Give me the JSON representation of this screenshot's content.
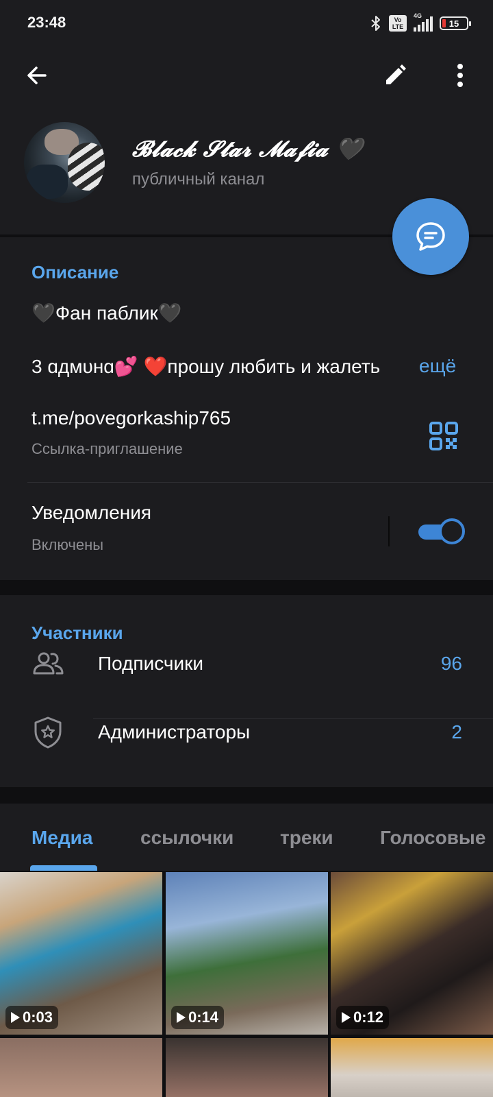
{
  "status_bar": {
    "time": "23:48",
    "network": "4G",
    "volte": "Vo LTE",
    "battery": "15"
  },
  "header": {
    "channel_name": "𝓑𝓵𝓪𝓬𝓴 𝓢𝓽𝓪𝓻 𝓜𝓪𝓯𝓲𝓪 🖤",
    "channel_type": "публичный канал"
  },
  "info": {
    "description_title": "Описание",
    "description_line1": "🖤Фан паблик🖤",
    "description_line2": "3 ɑдмυнɑ💕 ❤️прошу любить и жалеть",
    "more_label": "ещё",
    "invite_link": "t.me/povegorkaship765",
    "invite_caption": "Ссылка-приглашение",
    "notifications_title": "Уведомления",
    "notifications_status": "Включены",
    "notifications_on": true
  },
  "members": {
    "title": "Участники",
    "rows": [
      {
        "label": "Подписчики",
        "count": "96",
        "icon": "people-icon"
      },
      {
        "label": "Администраторы",
        "count": "2",
        "icon": "shield-star-icon"
      }
    ]
  },
  "tabs": [
    {
      "label": "Медиа",
      "active": true
    },
    {
      "label": "ссылочки",
      "active": false
    },
    {
      "label": "треки",
      "active": false
    },
    {
      "label": "Голосовые",
      "active": false
    }
  ],
  "media": [
    {
      "duration": "0:03"
    },
    {
      "duration": "0:14"
    },
    {
      "duration": "0:12"
    },
    {
      "duration": ""
    },
    {
      "duration": ""
    },
    {
      "duration": ""
    }
  ],
  "colors": {
    "accent": "#5aa6ec",
    "fab": "#4a90d9",
    "background": "#1c1c1f",
    "secondary_text": "#8e8e93"
  }
}
